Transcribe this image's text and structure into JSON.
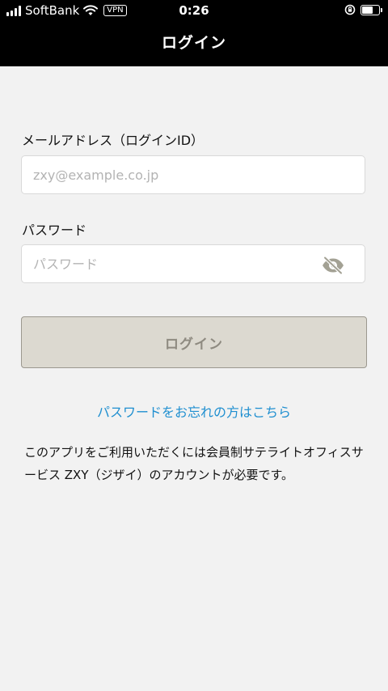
{
  "status_bar": {
    "carrier": "SoftBank",
    "vpn": "VPN",
    "time": "0:26"
  },
  "header": {
    "title": "ログイン"
  },
  "form": {
    "email_label": "メールアドレス（ログインID）",
    "email_placeholder": "zxy@example.co.jp",
    "email_value": "",
    "password_label": "パスワード",
    "password_placeholder": "パスワード",
    "password_value": "",
    "login_button": "ログイン"
  },
  "forgot_link": "パスワードをお忘れの方はこちら",
  "note": "このアプリをご利用いただくには会員制サテライトオフィスサービス ZXY（ジザイ）のアカウントが必要です。",
  "icons": {
    "signal": "signal-icon",
    "wifi": "wifi-icon",
    "rotation_lock": "rotation-lock-icon",
    "battery": "battery-icon",
    "password_visibility": "eye-slash-icon"
  },
  "colors": {
    "header_bg": "#000000",
    "background": "#f2f2f2",
    "link": "#1f8fd0",
    "button_bg": "#dcd9d0",
    "button_text": "#8e8a80"
  }
}
